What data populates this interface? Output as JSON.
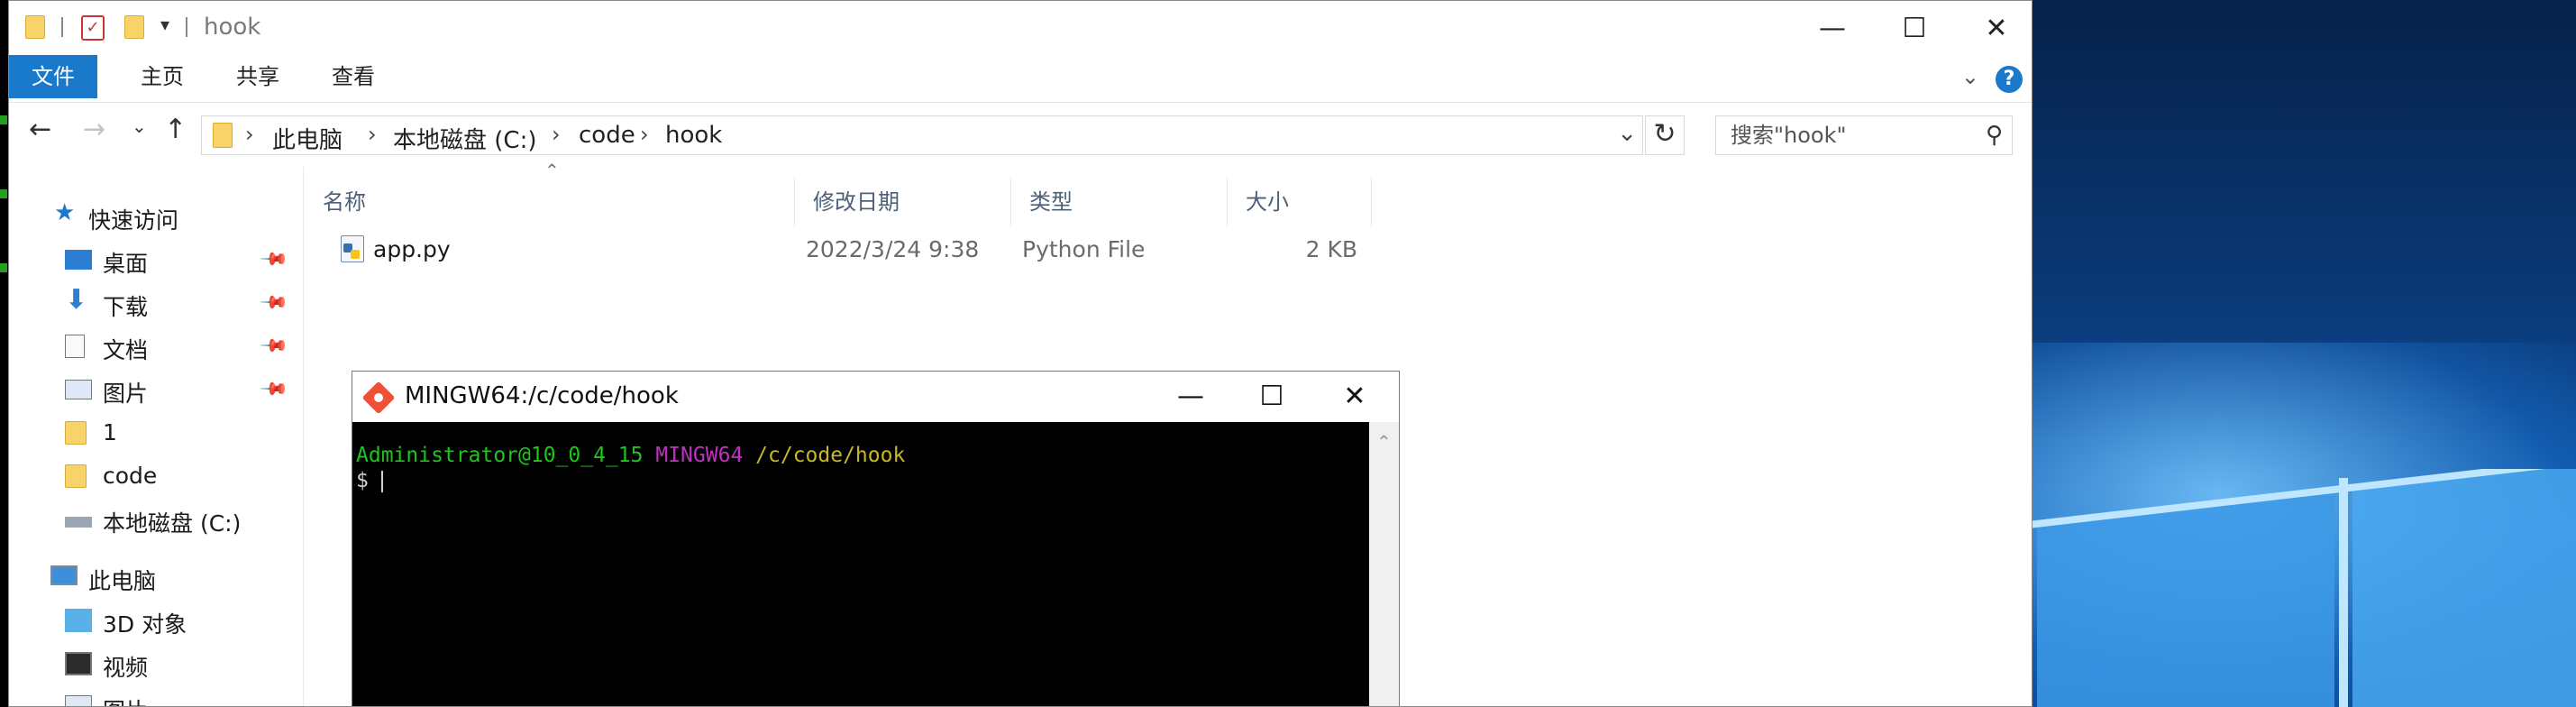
{
  "explorer": {
    "title": "hook",
    "ribbon_tabs": [
      "文件",
      "主页",
      "共享",
      "查看"
    ],
    "breadcrumb": [
      "此电脑",
      "本地磁盘 (C:)",
      "code",
      "hook"
    ],
    "search_placeholder": "搜索\"hook\"",
    "columns": [
      "名称",
      "修改日期",
      "类型",
      "大小"
    ],
    "files": [
      {
        "name": "app.py",
        "modified": "2022/3/24 9:38",
        "type": "Python File",
        "size": "2 KB"
      }
    ],
    "sidebar": {
      "quick_access": "快速访问",
      "items": [
        "桌面",
        "下载",
        "文档",
        "图片",
        "1",
        "code",
        "本地磁盘 (C:)"
      ],
      "this_pc": "此电脑",
      "pc_items": [
        "3D 对象",
        "视频",
        "图片"
      ]
    },
    "accent_color": "#1979ca"
  },
  "terminal": {
    "title": "MINGW64:/c/code/hook",
    "prompt_user": "Administrator@10_0_4_15",
    "prompt_system": "MINGW64",
    "prompt_path": "/c/code/hook",
    "prompt_symbol": "$"
  }
}
